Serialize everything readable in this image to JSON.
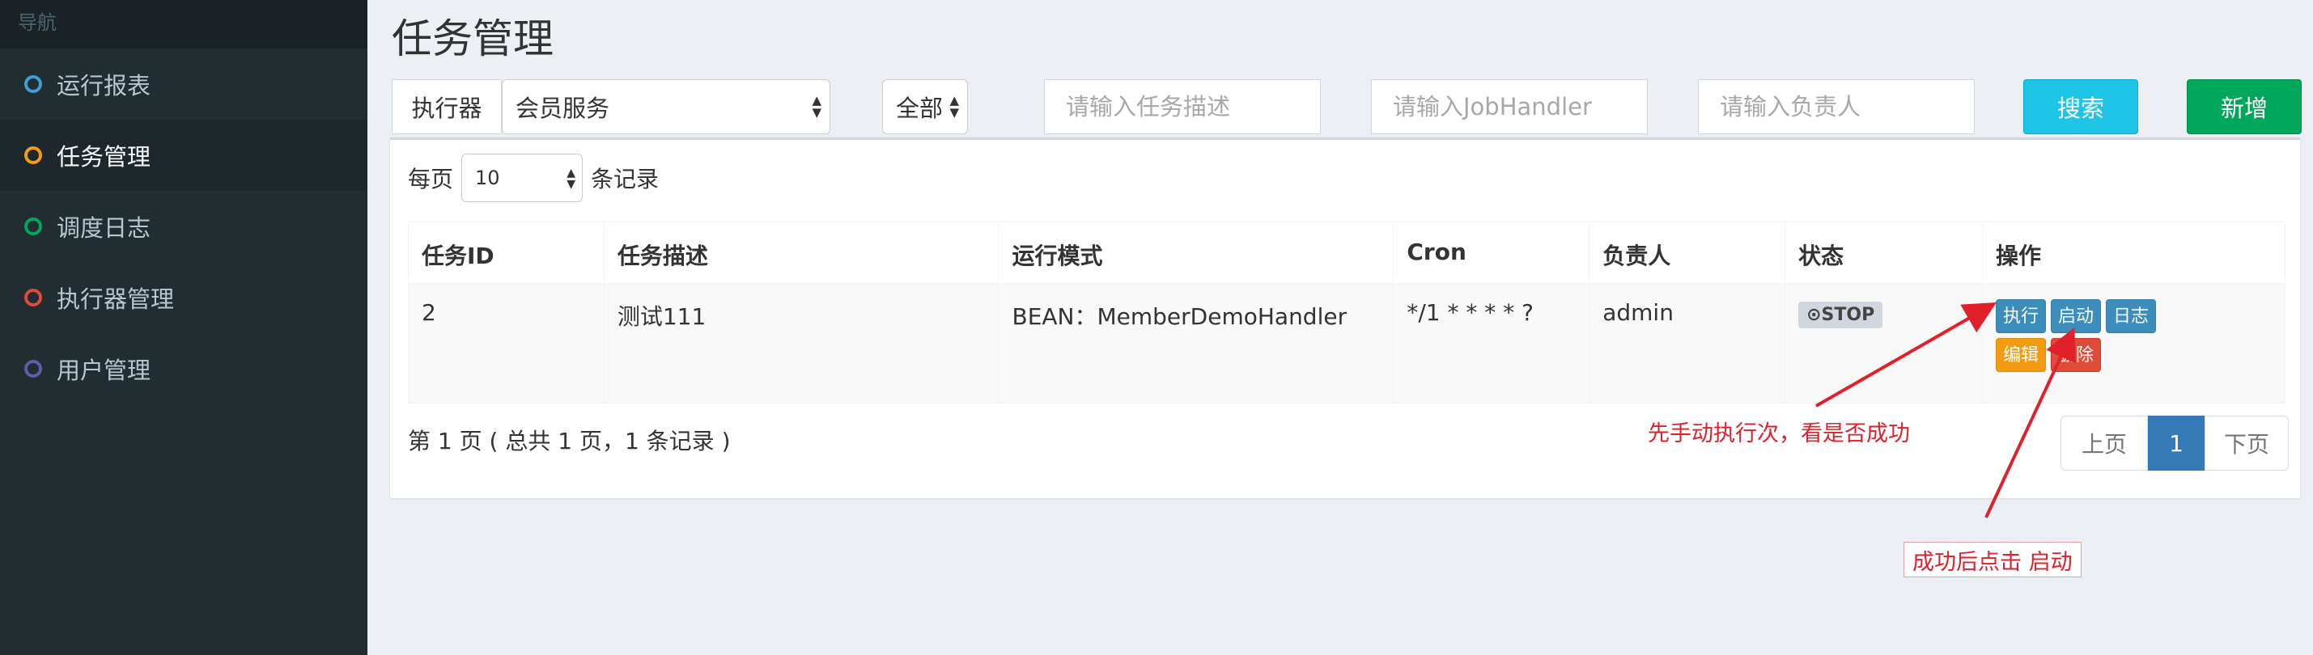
{
  "sidebar": {
    "header": "导航",
    "items": [
      {
        "label": "运行报表",
        "color": "#3c9dd8"
      },
      {
        "label": "任务管理",
        "color": "#f39c12"
      },
      {
        "label": "调度日志",
        "color": "#00a65a"
      },
      {
        "label": "执行器管理",
        "color": "#dd4b39"
      },
      {
        "label": "用户管理",
        "color": "#605ca8"
      }
    ],
    "active_index": 1
  },
  "page_title": "任务管理",
  "filters": {
    "executor_label": "执行器",
    "executor_value": "会员服务",
    "status_value": "全部",
    "job_desc_placeholder": "请输入任务描述",
    "handler_placeholder": "请输入JobHandler",
    "author_placeholder": "请输入负责人",
    "search_label": "搜索",
    "add_label": "新增"
  },
  "page_size": {
    "prefix": "每页",
    "value": "10",
    "suffix": "条记录"
  },
  "table": {
    "columns": [
      "任务ID",
      "任务描述",
      "运行模式",
      "Cron",
      "负责人",
      "状态",
      "操作"
    ],
    "rows": [
      {
        "id": "2",
        "desc": "测试111",
        "mode": "BEAN：MemberDemoHandler",
        "cron": "*/1 * * * * ?",
        "author": "admin",
        "status": "⊙STOP",
        "ops": {
          "trigger": "执行",
          "start": "启动",
          "log": "日志",
          "edit": "编辑",
          "delete": "删除"
        }
      }
    ]
  },
  "pagination": {
    "info": "第 1 页 ( 总共 1 页，1 条记录 )",
    "prev": "上页",
    "current": "1",
    "next": "下页"
  },
  "annotations": {
    "note1": "先手动执行次，看是否成功",
    "note2": "成功后点击 启动",
    "color": "#e0202a"
  }
}
